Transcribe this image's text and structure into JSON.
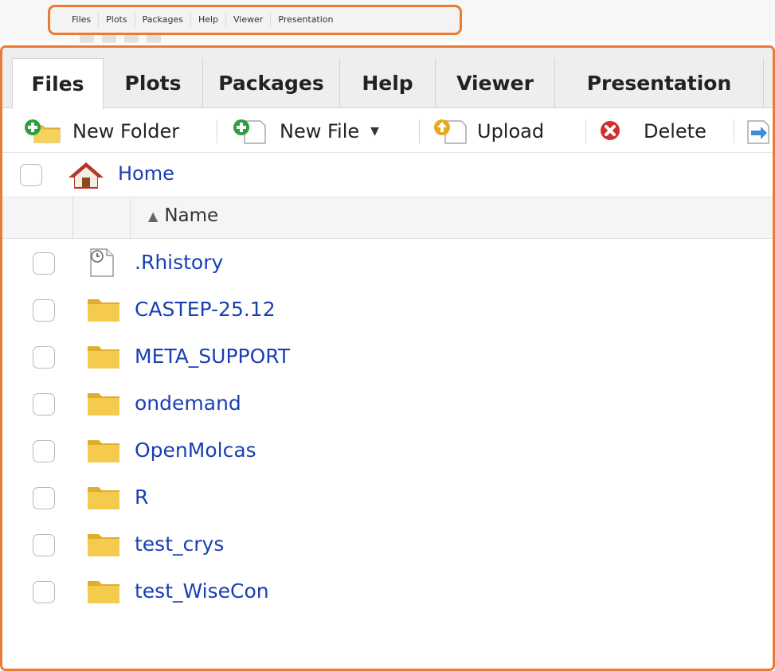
{
  "top_strip": {
    "tabs": [
      "Files",
      "Plots",
      "Packages",
      "Help",
      "Viewer",
      "Presentation"
    ]
  },
  "tabs": [
    {
      "label": "Files",
      "active": true
    },
    {
      "label": "Plots"
    },
    {
      "label": "Packages"
    },
    {
      "label": "Help"
    },
    {
      "label": "Viewer"
    },
    {
      "label": "Presentation"
    }
  ],
  "toolbar": {
    "new_folder": "New Folder",
    "new_file": "New File",
    "upload": "Upload",
    "delete": "Delete"
  },
  "breadcrumb": {
    "home": "Home"
  },
  "columns": {
    "name": "Name",
    "sort_indicator": "▲"
  },
  "files": [
    {
      "name": ".Rhistory",
      "icon": "history-file-icon"
    },
    {
      "name": "CASTEP-25.12",
      "icon": "folder-icon"
    },
    {
      "name": "META_SUPPORT",
      "icon": "folder-icon"
    },
    {
      "name": "ondemand",
      "icon": "folder-icon"
    },
    {
      "name": "OpenMolcas",
      "icon": "folder-icon"
    },
    {
      "name": "R",
      "icon": "folder-icon"
    },
    {
      "name": "test_crys",
      "icon": "folder-icon"
    },
    {
      "name": "test_WiseCon",
      "icon": "folder-icon"
    }
  ],
  "colors": {
    "highlight_border": "#ec7a33",
    "link": "#1a3fb3",
    "folder": "#f2c544"
  }
}
